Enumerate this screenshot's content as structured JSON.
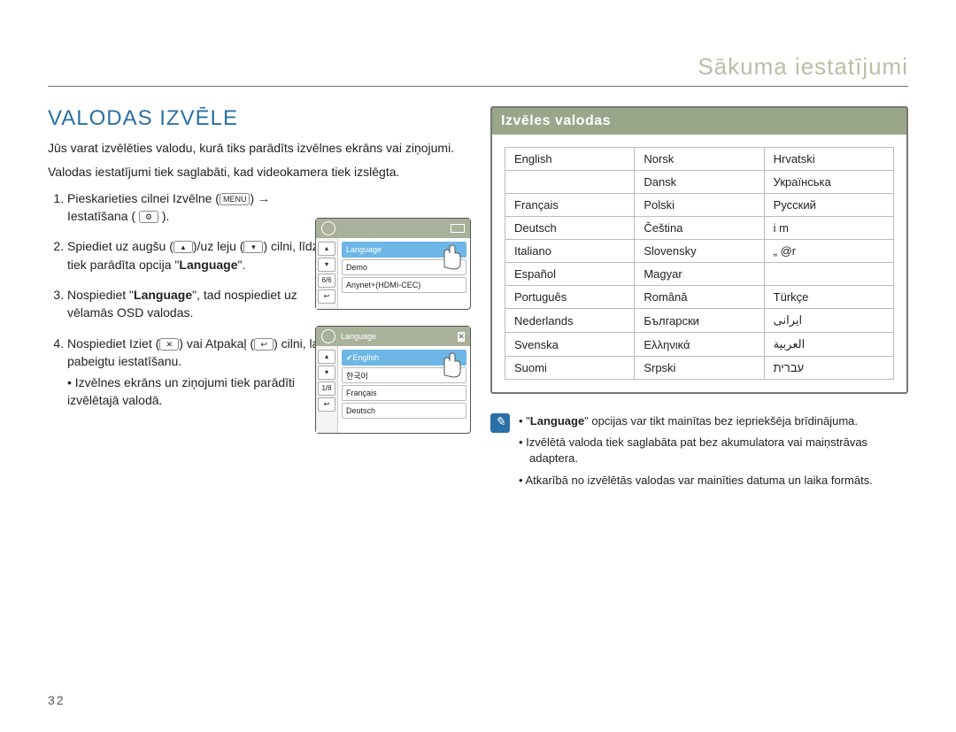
{
  "header": {
    "running_title": "Sākuma iestatījumi"
  },
  "section": {
    "title": "VALODAS IZVĒLE",
    "intro1": "Jūs varat izvēlēties valodu, kurā tiks parādīts izvēlnes ekrāns vai ziņojumi.",
    "intro2": "Valodas iestatījumi tiek saglabāti, kad videokamera tiek izslēgta."
  },
  "steps": {
    "s1a": "Pieskarieties cilnei Izvēlne",
    "s1b": "Iestatīšana (",
    "s1c": ").",
    "s2a": "Spiediet uz augšu (",
    "s2b": ")/uz leju (",
    "s2c": ") cilni, līdz tiek parādīta opcija \"",
    "s2d": "\".",
    "s3a": "Nospiediet \"",
    "s3b": "\", tad nospiediet uz vēlamās OSD valodas.",
    "s4a": "Nospiediet Iziet (",
    "s4b": ") vai Atpakaļ (",
    "s4c": ") cilni, lai pabeigtu iestatīšanu.",
    "s4note": "Izvēlnes ekrāns un ziņojumi tiek parādīti izvēlētajā valodā.",
    "language_bold": "Language"
  },
  "menu_chip": "MENU",
  "icons": {
    "gear": "⚙",
    "up": "▴",
    "down": "▾",
    "x": "✕",
    "back": "↩"
  },
  "minishot1": {
    "top_label": "",
    "side_counter": "6/6",
    "rows": [
      "Language",
      "Demo",
      "Anynet+(HDMI-CEC)"
    ]
  },
  "minishot2": {
    "top_label": "Language",
    "side_counter": "1/8",
    "rows": [
      "English",
      "한국어",
      "Français",
      "Deutsch"
    ]
  },
  "lang_box": {
    "header": "Izvēles valodas",
    "rows": [
      [
        "English",
        "Norsk",
        "Hrvatski"
      ],
      [
        "",
        "Dansk",
        "Українська"
      ],
      [
        "Français",
        "Polski",
        "Русский"
      ],
      [
        "Deutsch",
        "Čeština",
        "i m"
      ],
      [
        "Italiano",
        "Slovensky",
        "„ @r"
      ],
      [
        "Español",
        "Magyar",
        ""
      ],
      [
        "Português",
        "Română",
        "Türkçe"
      ],
      [
        "Nederlands",
        "Български",
        "ایرانی"
      ],
      [
        "Svenska",
        "Ελληνικά",
        "العربية"
      ],
      [
        "Suomi",
        "Srpski",
        "עברית"
      ]
    ]
  },
  "notes": {
    "n1a": "\"",
    "n1b": "\" opcijas var tikt mainītas bez iepriekšēja brīdinājuma.",
    "n2": "Izvēlētā valoda tiek saglabāta pat bez akumulatora vai maiņstrāvas adaptera.",
    "n3": "Atkarībā no izvēlētās valodas var mainīties datuma un laika formāts."
  },
  "pagenum": "32"
}
